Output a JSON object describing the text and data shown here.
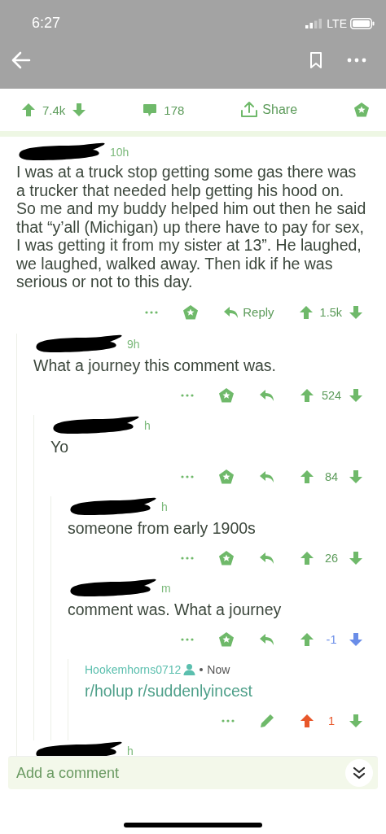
{
  "status_bar": {
    "time": "6:27",
    "network": "LTE"
  },
  "post_actions": {
    "score": "7.4k",
    "upvoted": false,
    "downvoted": false,
    "comment_count": "178",
    "share": "Share"
  },
  "comments": [
    {
      "redacted": true,
      "time": "10h",
      "body": "I was at a truck stop getting some gas there was a trucker that needed help getting his hood on. So me and my buddy helped him out then he said that “y’all (Michigan) up there have to pay for sex, I was getting it from my sister at 13”. He laughed, we laughed, walked away. Then idk if he was serious or not to this day.",
      "reply_label": "Reply",
      "score": "1.5k",
      "upvoted": false,
      "downvoted": false,
      "editable": false,
      "children": [
        {
          "redacted": true,
          "time": "9h",
          "body": "What a journey this comment was.",
          "score": "524",
          "upvoted": false,
          "downvoted": false,
          "editable": false,
          "children": [
            {
              "redacted": true,
              "time": "h",
              "body": "Yo",
              "score": "84",
              "upvoted": false,
              "downvoted": false,
              "editable": false,
              "children": [
                {
                  "redacted": true,
                  "time": "h",
                  "body": "someone from early 1900s",
                  "score": "26",
                  "upvoted": false,
                  "downvoted": false,
                  "editable": false
                },
                {
                  "redacted": true,
                  "time": "m",
                  "body": "comment was. What a journey",
                  "score": "-1",
                  "upvoted": false,
                  "downvoted": true,
                  "editable": false,
                  "children": [
                    {
                      "redacted": false,
                      "author": "Hookemhorns0712",
                      "time": "Now",
                      "body": "r/holup r/suddenlyincest",
                      "score": "1",
                      "upvoted": true,
                      "downvoted": false,
                      "editable": true
                    }
                  ]
                }
              ]
            }
          ]
        },
        {
          "redacted": true,
          "time": "h"
        }
      ]
    }
  ],
  "composer": {
    "placeholder": "Add a comment"
  }
}
